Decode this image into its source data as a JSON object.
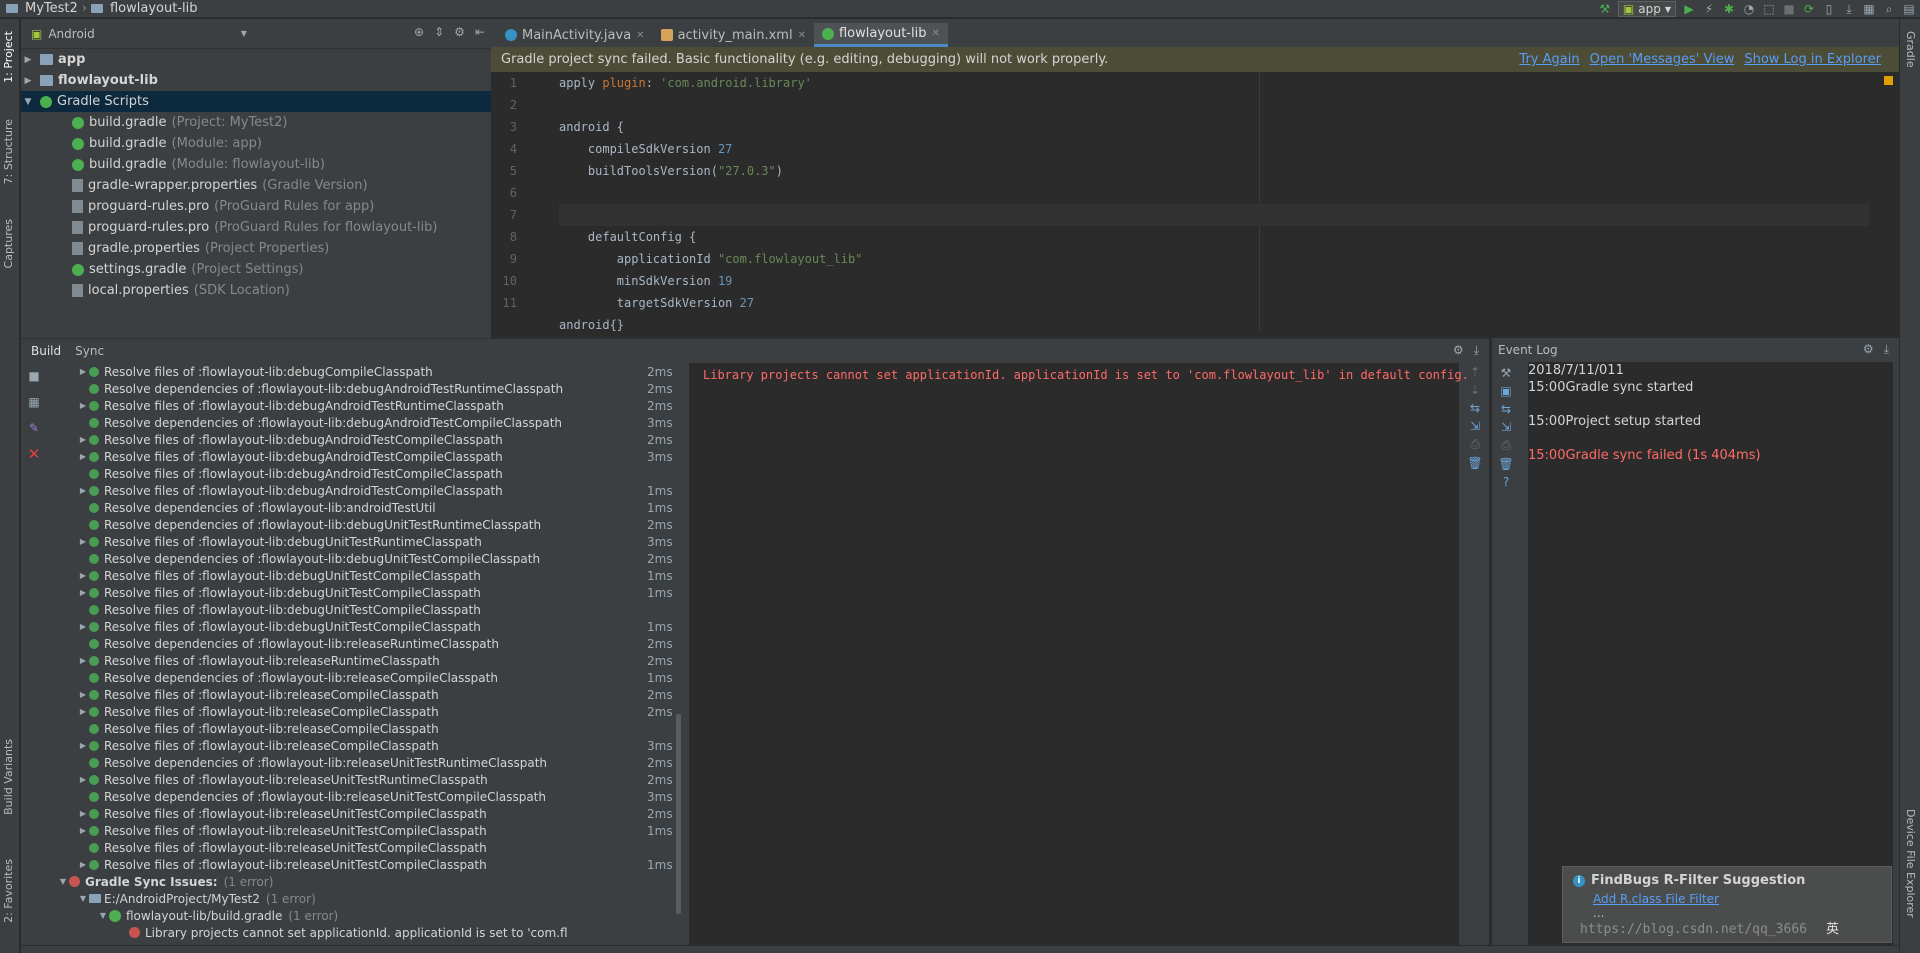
{
  "breadcrumbs": [
    "MyTest2",
    "flowlayout-lib"
  ],
  "toolbar": {
    "run_config": "app"
  },
  "left_stripe": {
    "project": "1: Project",
    "structure": "7: Structure",
    "captures": "Captures",
    "build_variants": "Build Variants",
    "favorites": "2: Favorites"
  },
  "right_stripe": {
    "gradle": "Gradle",
    "device_explorer": "Device File Explorer"
  },
  "project_panel": {
    "view": "Android",
    "items": [
      {
        "label": "app",
        "hint": "",
        "indent": 0,
        "arrow": "▶",
        "icon": "module",
        "bold": true
      },
      {
        "label": "flowlayout-lib",
        "hint": "",
        "indent": 0,
        "arrow": "▶",
        "icon": "module",
        "bold": true
      },
      {
        "label": "Gradle Scripts",
        "hint": "",
        "indent": 0,
        "arrow": "▼",
        "icon": "gradle",
        "bold": false,
        "selected": true
      },
      {
        "label": "build.gradle",
        "hint": "(Project: MyTest2)",
        "indent": 1,
        "arrow": "",
        "icon": "gradle"
      },
      {
        "label": "build.gradle",
        "hint": "(Module: app)",
        "indent": 1,
        "arrow": "",
        "icon": "gradle"
      },
      {
        "label": "build.gradle",
        "hint": "(Module: flowlayout-lib)",
        "indent": 1,
        "arrow": "",
        "icon": "gradle"
      },
      {
        "label": "gradle-wrapper.properties",
        "hint": "(Gradle Version)",
        "indent": 1,
        "arrow": "",
        "icon": "prop"
      },
      {
        "label": "proguard-rules.pro",
        "hint": "(ProGuard Rules for app)",
        "indent": 1,
        "arrow": "",
        "icon": "prop"
      },
      {
        "label": "proguard-rules.pro",
        "hint": "(ProGuard Rules for flowlayout-lib)",
        "indent": 1,
        "arrow": "",
        "icon": "prop"
      },
      {
        "label": "gradle.properties",
        "hint": "(Project Properties)",
        "indent": 1,
        "arrow": "",
        "icon": "prop"
      },
      {
        "label": "settings.gradle",
        "hint": "(Project Settings)",
        "indent": 1,
        "arrow": "",
        "icon": "gradle"
      },
      {
        "label": "local.properties",
        "hint": "(SDK Location)",
        "indent": 1,
        "arrow": "",
        "icon": "prop"
      }
    ]
  },
  "editor": {
    "tabs": [
      {
        "label": "MainActivity.java",
        "icon": "java",
        "active": false
      },
      {
        "label": "activity_main.xml",
        "icon": "xml",
        "active": false
      },
      {
        "label": "flowlayout-lib",
        "icon": "gradle",
        "active": true
      }
    ],
    "banner": {
      "message": "Gradle project sync failed. Basic functionality (e.g. editing, debugging) will not work properly.",
      "links": [
        "Try Again",
        "Open 'Messages' View",
        "Show Log in Explorer"
      ]
    },
    "lines": [
      {
        "n": "1",
        "html": "apply <span class=\"kw\">plugin</span>: <span class=\"str\">'com.android.library'</span>"
      },
      {
        "n": "2",
        "html": ""
      },
      {
        "n": "3",
        "html": "android {"
      },
      {
        "n": "4",
        "html": "    compileSdkVersion <span class=\"num\">27</span>"
      },
      {
        "n": "5",
        "html": "    buildToolsVersion(<span class=\"str\">\"27.0.3\"</span>)"
      },
      {
        "n": "6",
        "html": ""
      },
      {
        "n": "7",
        "html": "",
        "current": true
      },
      {
        "n": "8",
        "html": "    defaultConfig {"
      },
      {
        "n": "9",
        "html": "        applicationId <span class=\"str\">\"com.flowlayout_lib\"</span>"
      },
      {
        "n": "10",
        "html": "        minSdkVersion <span class=\"num\">19</span>"
      },
      {
        "n": "11",
        "html": "        targetSdkVersion <span class=\"num\">27</span>"
      }
    ],
    "code_breadcrumb": "android{}"
  },
  "build_panel": {
    "tabs": [
      "Build",
      "Sync"
    ],
    "rows": [
      {
        "arrow": "▶",
        "indent": 1,
        "icon": "ok",
        "label": "Resolve files of :flowlayout-lib:debugCompileClasspath",
        "time": "2ms"
      },
      {
        "arrow": "",
        "indent": 1,
        "icon": "ok",
        "label": "Resolve dependencies of :flowlayout-lib:debugAndroidTestRuntimeClasspath",
        "time": "2ms"
      },
      {
        "arrow": "▶",
        "indent": 1,
        "icon": "ok",
        "label": "Resolve files of :flowlayout-lib:debugAndroidTestRuntimeClasspath",
        "time": "2ms"
      },
      {
        "arrow": "",
        "indent": 1,
        "icon": "ok",
        "label": "Resolve dependencies of :flowlayout-lib:debugAndroidTestCompileClasspath",
        "time": "3ms"
      },
      {
        "arrow": "▶",
        "indent": 1,
        "icon": "ok",
        "label": "Resolve files of :flowlayout-lib:debugAndroidTestCompileClasspath",
        "time": "2ms"
      },
      {
        "arrow": "▶",
        "indent": 1,
        "icon": "ok",
        "label": "Resolve files of :flowlayout-lib:debugAndroidTestCompileClasspath",
        "time": "3ms"
      },
      {
        "arrow": "",
        "indent": 1,
        "icon": "ok",
        "label": "Resolve files of :flowlayout-lib:debugAndroidTestCompileClasspath",
        "time": ""
      },
      {
        "arrow": "▶",
        "indent": 1,
        "icon": "ok",
        "label": "Resolve files of :flowlayout-lib:debugAndroidTestCompileClasspath",
        "time": "1ms"
      },
      {
        "arrow": "",
        "indent": 1,
        "icon": "ok",
        "label": "Resolve dependencies of :flowlayout-lib:androidTestUtil",
        "time": "1ms"
      },
      {
        "arrow": "",
        "indent": 1,
        "icon": "ok",
        "label": "Resolve dependencies of :flowlayout-lib:debugUnitTestRuntimeClasspath",
        "time": "2ms"
      },
      {
        "arrow": "▶",
        "indent": 1,
        "icon": "ok",
        "label": "Resolve files of :flowlayout-lib:debugUnitTestRuntimeClasspath",
        "time": "3ms"
      },
      {
        "arrow": "",
        "indent": 1,
        "icon": "ok",
        "label": "Resolve dependencies of :flowlayout-lib:debugUnitTestCompileClasspath",
        "time": "2ms"
      },
      {
        "arrow": "▶",
        "indent": 1,
        "icon": "ok",
        "label": "Resolve files of :flowlayout-lib:debugUnitTestCompileClasspath",
        "time": "1ms"
      },
      {
        "arrow": "▶",
        "indent": 1,
        "icon": "ok",
        "label": "Resolve files of :flowlayout-lib:debugUnitTestCompileClasspath",
        "time": "1ms"
      },
      {
        "arrow": "",
        "indent": 1,
        "icon": "ok",
        "label": "Resolve files of :flowlayout-lib:debugUnitTestCompileClasspath",
        "time": ""
      },
      {
        "arrow": "▶",
        "indent": 1,
        "icon": "ok",
        "label": "Resolve files of :flowlayout-lib:debugUnitTestCompileClasspath",
        "time": "1ms"
      },
      {
        "arrow": "",
        "indent": 1,
        "icon": "ok",
        "label": "Resolve dependencies of :flowlayout-lib:releaseRuntimeClasspath",
        "time": "2ms"
      },
      {
        "arrow": "▶",
        "indent": 1,
        "icon": "ok",
        "label": "Resolve files of :flowlayout-lib:releaseRuntimeClasspath",
        "time": "2ms"
      },
      {
        "arrow": "",
        "indent": 1,
        "icon": "ok",
        "label": "Resolve dependencies of :flowlayout-lib:releaseCompileClasspath",
        "time": "1ms"
      },
      {
        "arrow": "▶",
        "indent": 1,
        "icon": "ok",
        "label": "Resolve files of :flowlayout-lib:releaseCompileClasspath",
        "time": "2ms"
      },
      {
        "arrow": "▶",
        "indent": 1,
        "icon": "ok",
        "label": "Resolve files of :flowlayout-lib:releaseCompileClasspath",
        "time": "2ms"
      },
      {
        "arrow": "",
        "indent": 1,
        "icon": "ok",
        "label": "Resolve files of :flowlayout-lib:releaseCompileClasspath",
        "time": ""
      },
      {
        "arrow": "▶",
        "indent": 1,
        "icon": "ok",
        "label": "Resolve files of :flowlayout-lib:releaseCompileClasspath",
        "time": "3ms"
      },
      {
        "arrow": "",
        "indent": 1,
        "icon": "ok",
        "label": "Resolve dependencies of :flowlayout-lib:releaseUnitTestRuntimeClasspath",
        "time": "2ms"
      },
      {
        "arrow": "▶",
        "indent": 1,
        "icon": "ok",
        "label": "Resolve files of :flowlayout-lib:releaseUnitTestRuntimeClasspath",
        "time": "2ms"
      },
      {
        "arrow": "",
        "indent": 1,
        "icon": "ok",
        "label": "Resolve dependencies of :flowlayout-lib:releaseUnitTestCompileClasspath",
        "time": "3ms"
      },
      {
        "arrow": "▶",
        "indent": 1,
        "icon": "ok",
        "label": "Resolve files of :flowlayout-lib:releaseUnitTestCompileClasspath",
        "time": "2ms"
      },
      {
        "arrow": "▶",
        "indent": 1,
        "icon": "ok",
        "label": "Resolve files of :flowlayout-lib:releaseUnitTestCompileClasspath",
        "time": "1ms"
      },
      {
        "arrow": "",
        "indent": 1,
        "icon": "ok",
        "label": "Resolve files of :flowlayout-lib:releaseUnitTestCompileClasspath",
        "time": ""
      },
      {
        "arrow": "▶",
        "indent": 1,
        "icon": "ok",
        "label": "Resolve files of :flowlayout-lib:releaseUnitTestCompileClasspath",
        "time": "1ms"
      },
      {
        "arrow": "▼",
        "indent": 0,
        "icon": "err",
        "label": "Gradle Sync Issues:",
        "hint": "(1 error)",
        "time": "",
        "bold": true
      },
      {
        "arrow": "▼",
        "indent": 1,
        "icon": "folder",
        "label": "E:/AndroidProject/MyTest2",
        "hint": "(1 error)",
        "time": ""
      },
      {
        "arrow": "▼",
        "indent": 2,
        "icon": "gradle",
        "label": "flowlayout-lib/build.gradle",
        "hint": "(1 error)",
        "time": ""
      },
      {
        "arrow": "",
        "indent": 3,
        "icon": "err",
        "label": "Library projects cannot set applicationId. applicationId is set to 'com.fl",
        "time": ""
      }
    ],
    "output": "Library projects cannot set applicationId. applicationId is set to 'com.flowlayout_lib' in default config."
  },
  "event_log": {
    "title": "Event Log",
    "date": "2018/7/11/011",
    "entries": [
      {
        "text": "15:00Gradle sync started",
        "error": false
      },
      {
        "text": "15:00Project setup started",
        "error": false
      },
      {
        "text": "15:00Gradle sync failed (1s 404ms)",
        "error": true
      }
    ]
  },
  "notification": {
    "title": "FindBugs R-Filter Suggestion",
    "link": "Add R.class File Filter",
    "more": "..."
  },
  "watermark": "https://blog.csdn.net/qq_3666",
  "ime": "英"
}
